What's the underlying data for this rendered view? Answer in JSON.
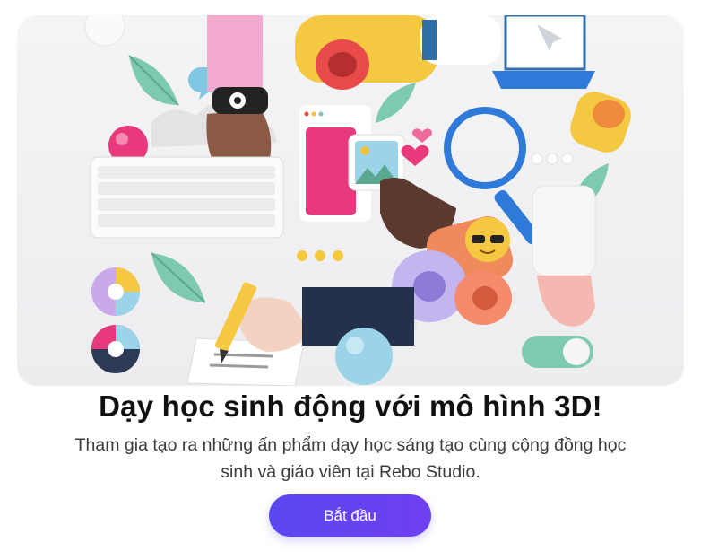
{
  "card": {
    "title": "Dạy học sinh động với mô hình 3D!",
    "description_line1": "Tham gia tạo ra những ấn phẩm dạy học sáng tạo cùng cộng đồng học",
    "description_line2": "sinh và giáo viên tại Rebo Studio.",
    "start_button": "Bắt đầu"
  },
  "colors": {
    "accent": "#5b48f0",
    "title": "#111111",
    "text": "#3b3b3b"
  },
  "illustration_icons": [
    "keyboard-icon",
    "hand-icon",
    "smartwatch-icon",
    "laptop-icon",
    "magnifier-icon",
    "image-icon",
    "pie-chart-icon",
    "pencil-icon",
    "toggle-icon",
    "leaf-icon",
    "heart-icon",
    "sunglasses-emoji-icon"
  ]
}
